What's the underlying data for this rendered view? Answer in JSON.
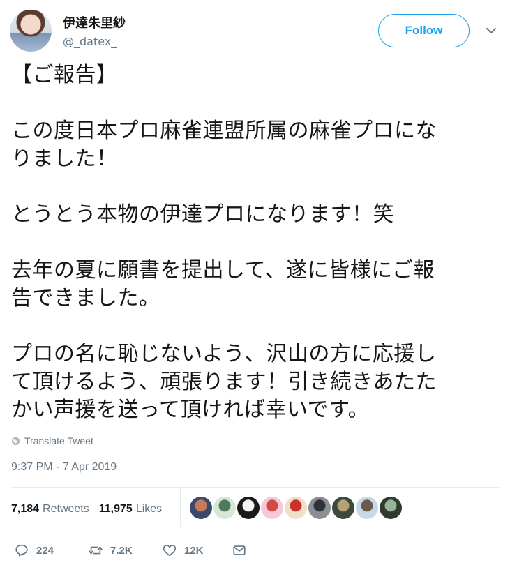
{
  "user": {
    "name": "伊達朱里紗",
    "handle": "@_datex_"
  },
  "follow_label": "Follow",
  "tweet": {
    "lines": [
      "【ご報告】",
      "",
      "この度日本プロ麻雀連盟所属の麻雀プロにな",
      "りました！",
      "",
      "とうとう本物の伊達プロになります！笑",
      "",
      "去年の夏に願書を提出して、遂に皆様にご報",
      "告できました。",
      "",
      "プロの名に恥じないよう、沢山の方に応援し",
      "て頂けるよう、頑張ります！引き続きあたた",
      "かい声援を送って頂ければ幸いです。"
    ]
  },
  "translate_label": "Translate Tweet",
  "timestamp": "9:37 PM - 7 Apr 2019",
  "stats": {
    "retweets_count": "7,184",
    "retweets_label": "Retweets",
    "likes_count": "11,975",
    "likes_label": "Likes"
  },
  "likers": [
    {
      "color_a": "#3b4a6b",
      "color_b": "#c57b5a"
    },
    {
      "color_a": "#d8e6d8",
      "color_b": "#4f7a5a"
    },
    {
      "color_a": "#1a1a1a",
      "color_b": "#f4f4f4"
    },
    {
      "color_a": "#f7c9d6",
      "color_b": "#d04a4a"
    },
    {
      "color_a": "#f1e0c8",
      "color_b": "#c8322e"
    },
    {
      "color_a": "#8a8f96",
      "color_b": "#2f3236"
    },
    {
      "color_a": "#3a4a3b",
      "color_b": "#b8a07a"
    },
    {
      "color_a": "#c7d8ea",
      "color_b": "#6b5a4a"
    },
    {
      "color_a": "#2e3b2f",
      "color_b": "#9bb39a"
    }
  ],
  "actions": {
    "reply_count": "224",
    "retweet_count": "7.2K",
    "like_count": "12K"
  },
  "colors": {
    "accent": "#1da1f2",
    "muted": "#657786",
    "divider": "#e6ecf0"
  }
}
